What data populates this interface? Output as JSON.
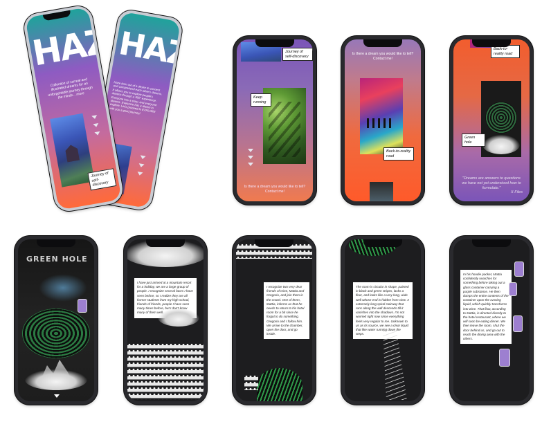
{
  "hero": {
    "logo_text": "HAZE",
    "intro": "Collection of surreal and illustrated dreams for an unforgettable journey through the minds... more",
    "back_intro": "Haze born out of a desire to connect and comprehend each other's dreams. It allows you to explore people's dreams through a 360° experience. Everyone has a story, and everyone dreams. Everyone has a dream to explore. Let's proceed to EXPLORE with you a good journey!",
    "caption": "Journey of self-discovery"
  },
  "screen_journey": {
    "caption_top": "Journey of self-discovery",
    "caption_mid": "Keep running",
    "footer": "Is there a dream you would like to tell? Contact me!"
  },
  "screen_reality": {
    "header": "Is there a dream you would like to tell? Contact me!",
    "caption": "Back-to-reality road"
  },
  "screen_greenhole": {
    "caption_top": "Back-to-reality road",
    "caption_mid": "Green hole",
    "quote": "\"Dreams are answers to questions we have not yet understood how to formulate.\"",
    "attribution": "X-Files"
  },
  "screen_title": {
    "title": "GREEN HOLE"
  },
  "screen_story1": {
    "text": "I have just arrived at a mountain resort for a holiday, we are a large group of people. I recognize several faces I have seen before, so I realize they are all former students from my high school, friends of friends, people I have seen many times before, but I don't know many of them well."
  },
  "screen_story2": {
    "text": "I recognize two very dear friends of mine, Mattia and Gregorio, and join them in the crowd. One of them, Mattia, informs us that he needs to return to his hotel room for a bit since he forgot to do something. Gregorio and I follow him. We arrive to the chamber, open the door, and go inside."
  },
  "screen_story3": {
    "text": "The room is circular in shape, painted in black and green stripes, lacks a floor, and looks like a very long, wide well whose end is hidden from view. A extremely long spiral stairway that runs along the wall descends till it vanishes into the shadows. I'm not worried right now since everything feels very regular to me. Unknown to us as its source, we see a clear liquid that like water running down the steps."
  },
  "screen_story4": {
    "text": "In his hoodie pocket, Mattia confidently searches for something before taking out a glass container carrying a purple substance. He then dumps the entire contents of the container upon the running liquid, which quickly transforms into wine. That flow, according to Mattia, is directed directly to the hotel restaurant, where we will soon be eating dinner. We then leave the room, shut the door behind us, and go out to reach the dining area with the others."
  },
  "icons": {
    "nav": "triangle-down-icon"
  },
  "colors": {
    "haze_purple": "#7b55b8",
    "haze_teal": "#1fa39b",
    "haze_orange": "#ff6a3a",
    "dark_screen": "#1b1b1d",
    "frame": "#2a2a2e"
  }
}
